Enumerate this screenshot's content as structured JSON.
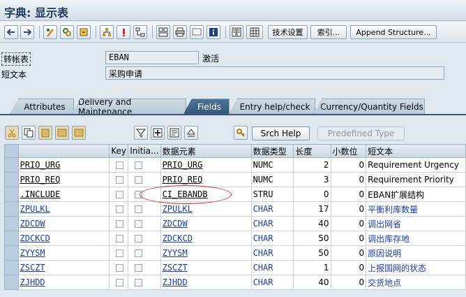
{
  "window": {
    "title": "字典: 显示表"
  },
  "toolbar": {
    "tech_settings": "技术设置",
    "index": "索引...",
    "append_structure": "Append Structure..."
  },
  "header": {
    "transp_table_label": "转帐表",
    "table_name": "EBAN",
    "status": "激活",
    "short_text_label": "短文本",
    "short_text": "采购申请"
  },
  "tabs": [
    {
      "label": "Attributes"
    },
    {
      "label": "Delivery and Maintenance"
    },
    {
      "label": "Fields",
      "active": true
    },
    {
      "label": "Entry help/check"
    },
    {
      "label": "Currency/Quantity Fields"
    }
  ],
  "fields_toolbar": {
    "srch_help": "Srch Help",
    "predefined_type": "Predefined Type"
  },
  "columns": [
    "Key",
    "Initia...",
    "数据元素",
    "数据类型",
    "长度",
    "小数位",
    "短文本"
  ],
  "rows": [
    {
      "field": "PRIO_URG",
      "element": "PRIO_URG",
      "type": "NUMC",
      "length": "2",
      "decimals": "0",
      "text": "Requirement Urgency",
      "cn": false
    },
    {
      "field": "PRIO_REQ",
      "element": "PRIO_REQ",
      "type": "NUMC",
      "length": "3",
      "decimals": "0",
      "text": "Requirement Priority",
      "cn": false
    },
    {
      "field": ".INCLUDE",
      "element": "CI_EBANDB",
      "type": "STRU",
      "length": "0",
      "decimals": "0",
      "text": "EBAN扩展结构",
      "cn": false
    },
    {
      "field": "ZPULKL",
      "element": "ZPULKL",
      "type": "CHAR",
      "length": "17",
      "decimals": "0",
      "text": "平衡利库数量",
      "cn": true
    },
    {
      "field": "ZDCDW",
      "element": "ZDCDW",
      "type": "CHAR",
      "length": "40",
      "decimals": "0",
      "text": "调出网省",
      "cn": true
    },
    {
      "field": "ZDCKCD",
      "element": "ZDCKCD",
      "type": "CHAR",
      "length": "50",
      "decimals": "0",
      "text": "调出库存地",
      "cn": true
    },
    {
      "field": "ZYYSM",
      "element": "ZYYSM",
      "type": "CHAR",
      "length": "50",
      "decimals": "0",
      "text": "原因说明",
      "cn": true
    },
    {
      "field": "ZSCZT",
      "element": "ZSCZT",
      "type": "CHAR",
      "length": "1",
      "decimals": "0",
      "text": "上报国网的状态",
      "cn": true
    },
    {
      "field": "ZJHDD",
      "element": "ZJHDD",
      "type": "CHAR",
      "length": "40",
      "decimals": "0",
      "text": "交货地点",
      "cn": true
    }
  ]
}
